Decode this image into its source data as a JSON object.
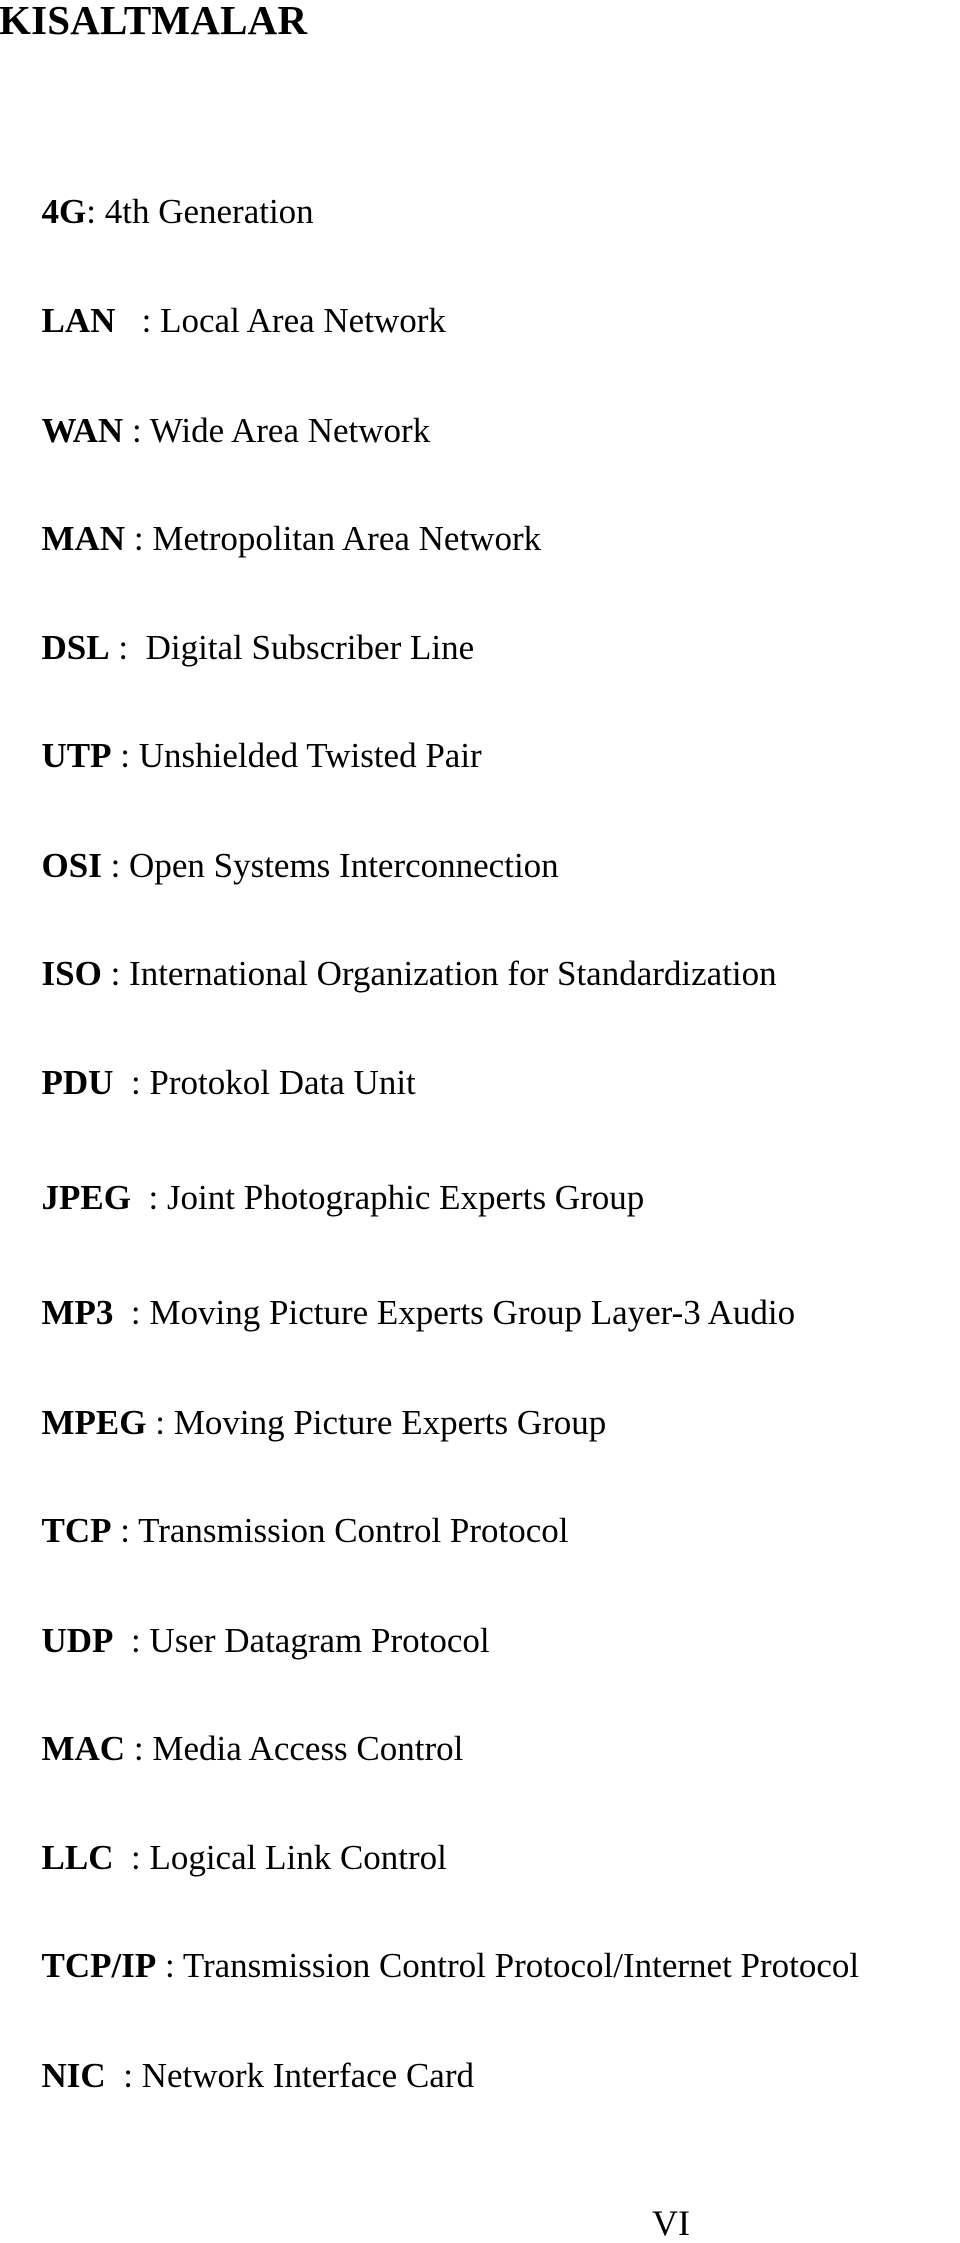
{
  "page": {
    "title": "KISALTMALAR",
    "page_number": "VI"
  },
  "entries": [
    {
      "abbr": "4G",
      "sep": ": ",
      "desc": "4th Generation"
    },
    {
      "abbr": "LAN",
      "sep": "   : ",
      "desc": "Local Area Network"
    },
    {
      "abbr": "WAN",
      "sep": " : ",
      "desc": "Wide Area Network"
    },
    {
      "abbr": "MAN",
      "sep": " : ",
      "desc": "Metropolitan Area Network"
    },
    {
      "abbr": "DSL",
      "sep": " :  ",
      "desc": "Digital Subscriber Line"
    },
    {
      "abbr": "UTP",
      "sep": " : ",
      "desc": "Unshielded Twisted Pair"
    },
    {
      "abbr": "OSI",
      "sep": " : ",
      "desc": "Open Systems Interconnection"
    },
    {
      "abbr": "ISO",
      "sep": " : ",
      "desc": "International Organization for Standardization"
    },
    {
      "abbr": "PDU",
      "sep": "  : ",
      "desc": "Protokol Data Unit"
    },
    {
      "abbr": "JPEG",
      "sep": "  : ",
      "desc": "Joint Photographic Experts Group"
    },
    {
      "abbr": "MP3",
      "sep": "  : ",
      "desc": "Moving Picture Experts Group Layer-3 Audio"
    },
    {
      "abbr": "MPEG",
      "sep": " : ",
      "desc": "Moving Picture Experts Group"
    },
    {
      "abbr": "TCP",
      "sep": " : ",
      "desc": "Transmission Control Protocol"
    },
    {
      "abbr": "UDP",
      "sep": "  : ",
      "desc": "User Datagram Protocol"
    },
    {
      "abbr": "MAC",
      "sep": " : ",
      "desc": "Media Access Control"
    },
    {
      "abbr": "LLC",
      "sep": "  : ",
      "desc": "Logical Link Control"
    },
    {
      "abbr": "TCP/IP",
      "sep": " : ",
      "desc": "Transmission Control Protocol/Internet Protocol"
    },
    {
      "abbr": "NIC",
      "sep": "  : ",
      "desc": "Network Interface Card"
    }
  ]
}
